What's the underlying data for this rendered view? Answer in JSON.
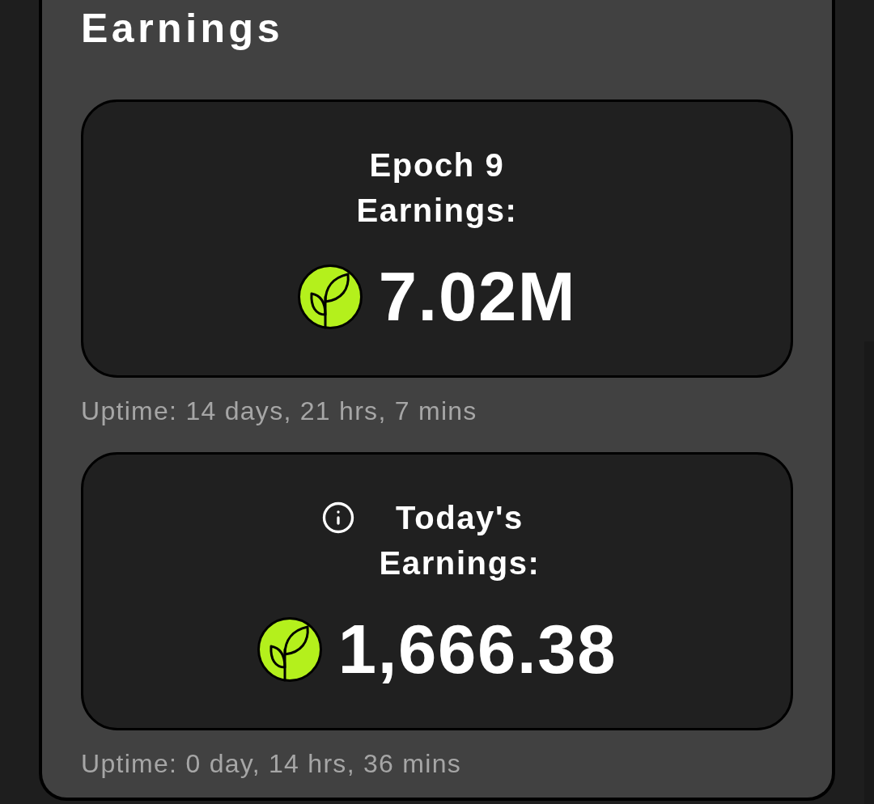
{
  "panel": {
    "title": "Earnings",
    "cards": [
      {
        "title": "Epoch 9 Earnings:",
        "info": false,
        "value": "7.02M",
        "uptime": "Uptime: 14 days, 21 hrs, 7 mins"
      },
      {
        "title": "Today's Earnings:",
        "info": true,
        "value": "1,666.38",
        "uptime": "Uptime: 0 day, 14 hrs, 36 mins"
      }
    ]
  }
}
